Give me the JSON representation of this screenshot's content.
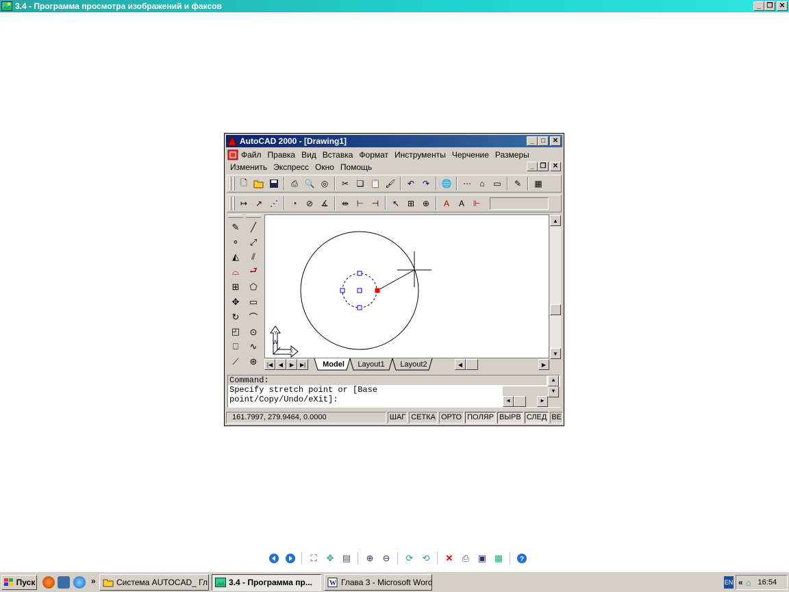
{
  "viewer": {
    "title": "3.4 - Программа просмотра изображений и факсов",
    "toolbar": [
      "prev-image-icon",
      "next-image-icon",
      "best-fit-icon",
      "actual-size-icon",
      "slideshow-icon",
      "zoom-in-icon",
      "zoom-out-icon",
      "rotate-cw-icon",
      "rotate-ccw-icon",
      "delete-icon",
      "print-icon",
      "save-icon",
      "edit-icon",
      "help-icon"
    ]
  },
  "acad": {
    "title": "AutoCAD 2000 - [Drawing1]",
    "menu1": [
      "Файл",
      "Правка",
      "Вид",
      "Вставка",
      "Формат",
      "Инструменты",
      "Черчение",
      "Размеры"
    ],
    "menu2": [
      "Изменить",
      "Экспресс",
      "Окно",
      "Помощь"
    ],
    "tabs": {
      "model": "Model",
      "layout1": "Layout1",
      "layout2": "Layout2"
    },
    "ucs": {
      "y": "Y",
      "w": "W",
      "x": "X"
    },
    "command": {
      "line1": "Command:",
      "line2": "Specify stretch point or [Base",
      "line3": "point/Copy/Undo/eXit]:"
    },
    "status": {
      "coords": "161.7997, 279.9464, 0.0000",
      "snap": "ШАГ",
      "grid": "СЕТКА",
      "ortho": "ОРТО",
      "polar": "ПОЛЯР",
      "osnap": "ВЫРВ",
      "otrack": "СЛЕД",
      "lwt": "ВЕ"
    }
  },
  "taskbar": {
    "start": "Пуск",
    "tasks": [
      "Система AUTOCAD_ Гл...",
      "3.4 - Программа пр...",
      "Глава 3 - Microsoft Word"
    ],
    "lang": "EN",
    "time": "16:54",
    "chevron": "»",
    "tray_chevron": "«"
  },
  "colors": {
    "viewer_title": "#1fd1ce",
    "acad_title": "#0a246a",
    "grip_hot": "#ff0000",
    "grip_cold": "#0000ff"
  }
}
